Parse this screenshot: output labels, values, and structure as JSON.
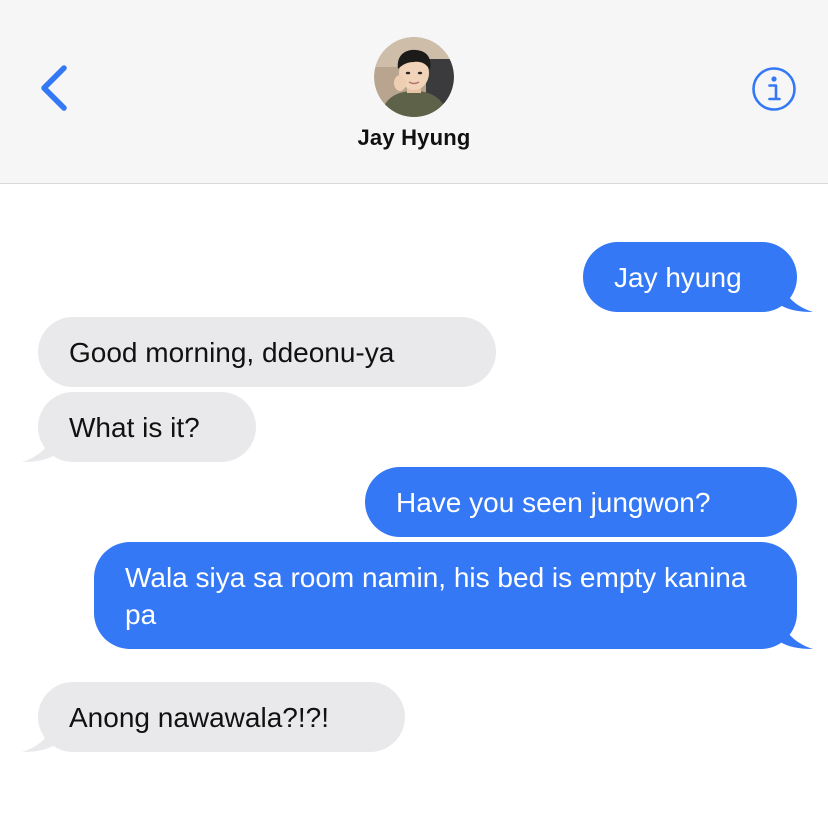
{
  "header": {
    "contact_name": "Jay Hyung",
    "back_icon": "chevron-left-icon",
    "info_icon": "info-circle-icon",
    "accent_color": "#3478f6"
  },
  "messages": [
    {
      "direction": "outgoing",
      "text": "Jay hyung"
    },
    {
      "direction": "incoming",
      "text": "Good morning, ddeonu-ya"
    },
    {
      "direction": "incoming",
      "text": "What is it?"
    },
    {
      "direction": "outgoing",
      "text": "Have you seen jungwon?"
    },
    {
      "direction": "outgoing",
      "text": "Wala siya sa room namin, his bed is empty kanina pa"
    },
    {
      "direction": "incoming",
      "text": "Anong nawawala?!?!"
    }
  ],
  "colors": {
    "outgoing_bubble": "#3478f6",
    "incoming_bubble": "#e9e9eb",
    "header_bg": "#f6f6f6"
  }
}
